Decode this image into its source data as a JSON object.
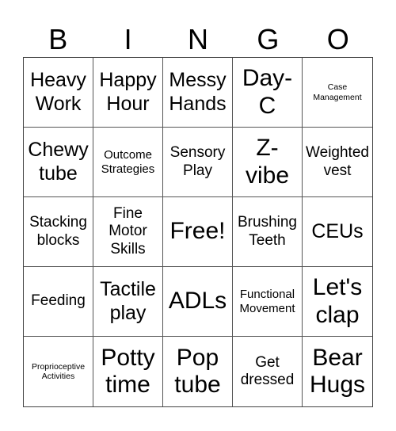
{
  "header": {
    "letters": [
      "B",
      "I",
      "N",
      "G",
      "O"
    ]
  },
  "board": {
    "rows": [
      [
        "Heavy Work",
        "Happy Hour",
        "Messy Hands",
        "Day-C",
        "Case Management"
      ],
      [
        "Chewy tube",
        "Outcome Strategies",
        "Sensory Play",
        "Z-vibe",
        "Weighted vest"
      ],
      [
        "Stacking blocks",
        "Fine Motor Skills",
        "Free!",
        "Brushing Teeth",
        "CEUs"
      ],
      [
        "Feeding",
        "Tactile play",
        "ADLs",
        "Functional Movement",
        "Let's clap"
      ],
      [
        "Proprioceptive Activities",
        "Potty time",
        "Pop tube",
        "Get dressed",
        "Bear Hugs"
      ]
    ],
    "free_space": "Free!"
  },
  "colors": {
    "grid_line": "#555555",
    "text": "#000000",
    "background": "#ffffff"
  }
}
